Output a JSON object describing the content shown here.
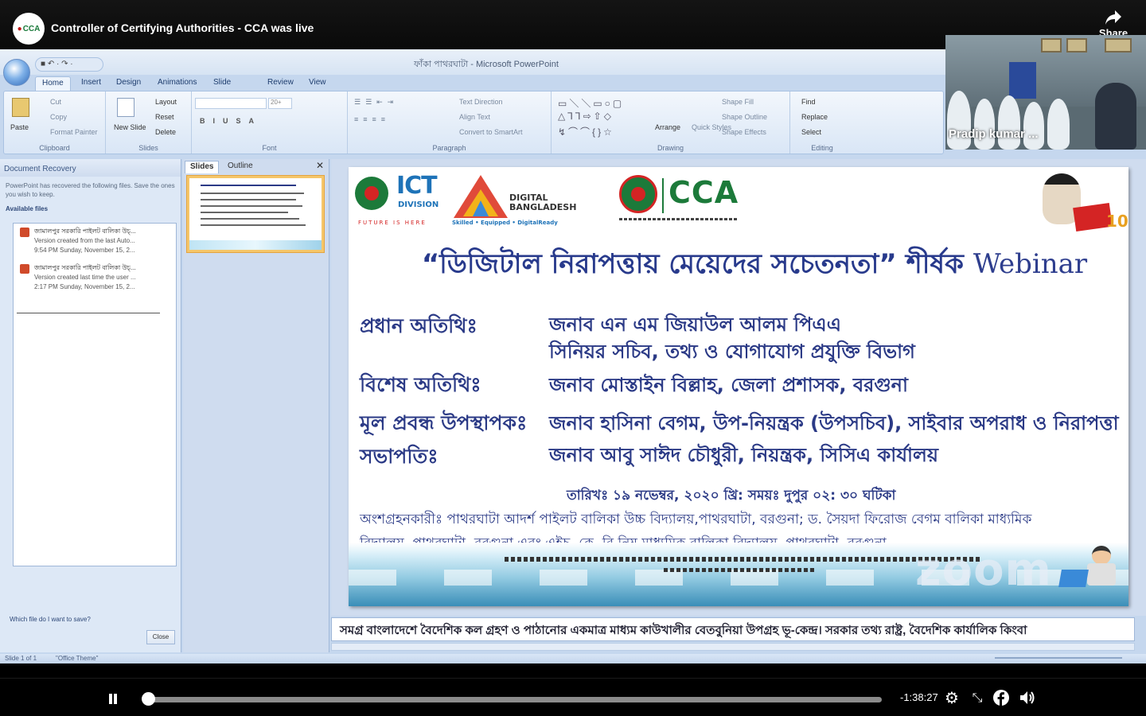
{
  "video": {
    "logo_text": "CCA",
    "title": "Controller of Certifying Authorities - CCA was live",
    "share_label": "Share"
  },
  "ppt": {
    "app_title": "ফাঁকা পাথরঘাটা - Microsoft PowerPoint",
    "qat": "■ ↶ · ↷ ·",
    "tabs": [
      "Home",
      "Insert",
      "Design",
      "Animations",
      "Slide Show",
      "Review",
      "View"
    ],
    "ribbon": {
      "clipboard": {
        "label": "Clipboard",
        "paste": "Paste",
        "cut": "Cut",
        "copy": "Copy",
        "format_painter": "Format Painter"
      },
      "slides": {
        "label": "Slides",
        "new_slide": "New Slide",
        "layout": "Layout",
        "reset": "Reset",
        "delete": "Delete"
      },
      "font": {
        "label": "Font",
        "size": "20+"
      },
      "paragraph": {
        "label": "Paragraph",
        "text_direction": "Text Direction",
        "align_text": "Align Text",
        "convert": "Convert to SmartArt"
      },
      "drawing": {
        "label": "Drawing",
        "arrange": "Arrange",
        "quick_styles": "Quick Styles",
        "shape_fill": "Shape Fill",
        "shape_outline": "Shape Outline",
        "shape_effects": "Shape Effects"
      },
      "editing": {
        "label": "Editing",
        "find": "Find",
        "replace": "Replace",
        "select": "Select"
      }
    },
    "recovery": {
      "title": "Document Recovery",
      "intro": "PowerPoint has recovered the following files. Save the ones you wish to keep.",
      "available": "Available files",
      "files": [
        {
          "name": "জামালপুর সরকারি পাইলট বালিকা উচ্...",
          "desc": "Version created from the last Auto...",
          "time": "9:54 PM Sunday, November 15, 2..."
        },
        {
          "name": "জামালপুর সরকারি পাইলট বালিকা উচ্...",
          "desc": "Version created last time the user ...",
          "time": "2:17 PM Sunday, November 15, 2..."
        }
      ],
      "help": "Which file do I want to save?",
      "close": "Close"
    },
    "slides_pane": {
      "tab_slides": "Slides",
      "tab_outline": "Outline",
      "close": "✕",
      "thumb_number": "1"
    },
    "slide": {
      "ict_big": "ICT",
      "ict_small": "DIVISION",
      "ict_tag": "FUTURE IS HERE",
      "db_line1": "DIGITAL",
      "db_line2": "BANGLADESH",
      "db_tag": "Skilled • Equipped • DigitalReady",
      "cca": "CCA",
      "mujib_num": "100",
      "headline_bn": "“ডিজিটাল নিরাপত্তায় মেয়েদের সচেতনতা” শীর্ষক",
      "headline_en": "Webinar",
      "rows": [
        {
          "label": "প্রধান অতিথিঃ",
          "value": "জনাব এন এম জিয়াউল আলম পিএএ"
        },
        {
          "label": "",
          "value": "সিনিয়র সচিব, তথ্য ও যোগাযোগ প্রযুক্তি বিভাগ"
        },
        {
          "label": "বিশেষ অতিথিঃ",
          "value": "জনাব মোস্তাইন বিল্লাহ, জেলা প্রশাসক, বরগুনা"
        },
        {
          "label": "মূল প্রবন্ধ উপস্থাপকঃ",
          "value": "জনাব হাসিনা বেগম, উপ-নিয়ন্ত্রক (উপসচিব), সাইবার অপরাধ ও নিরাপত্তা"
        },
        {
          "label": "সভাপতিঃ",
          "value": "জনাব আবু সাঈদ চৌধুরী, নিয়ন্ত্রক, সিসিএ কার্যালয়"
        }
      ],
      "date_line": "তারিখঃ ১৯ নভেম্বর, ২০২০ খ্রি: সময়ঃ দুপুর ০২: ৩০ ঘটিকা",
      "participants_1": "অংশগ্রহনকারীঃ পাথরঘাটা আদর্শ পাইলট বালিকা উচ্চ বিদ্যালয়,পাথরঘাটা, বরগুনা; ড. সৈয়দা ফিরোজ বেগম বালিকা মাধ্যমিক",
      "participants_2": "বিদ্যালয়, পাথরঘাটা, বরগুনা এবং এইচ. কে. বি নিম্ন মাধ্যমিক বালিকা বিদ্যালয়, পাথরঘাটা, বরগুনা"
    },
    "notes": "সমগ্র বাংলাদেশে বৈদেশিক কল গ্রহণ ও পাঠানোর একমাত্র মাধ্যম কাউখালীর বেতবুনিয়া উপগ্রহ ভূ-কেন্দ্র। সরকার তথ্য রাষ্ট্র, বৈদেশিক কার্যালিক কিংবা",
    "status": {
      "slide": "Slide 1 of 1",
      "theme": "\"Office Theme\""
    }
  },
  "zoom_watermark": "zoom",
  "webcam": {
    "name": "Pradip kumar ..."
  },
  "player": {
    "time_remaining": "-1:38:27",
    "progress": 0.0
  }
}
